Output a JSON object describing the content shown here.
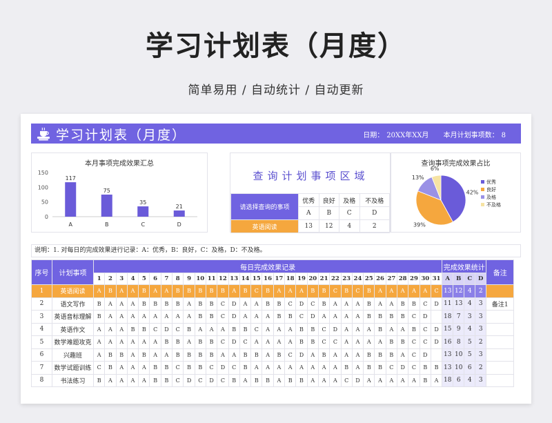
{
  "hero": {
    "title": "学习计划表（月度）",
    "subtitle": "简单易用  /  自动统计  /  自动更新"
  },
  "banner": {
    "title": "学习计划表（月度）",
    "date_label": "日期：",
    "date_value": "20XX年XX月",
    "count_label": "本月计划事项数：",
    "count_value": "8"
  },
  "bar_panel": {
    "title": "本月事项完成效果汇总"
  },
  "query_panel": {
    "title": "查询计划事项区域",
    "headers": [
      "优秀",
      "良好",
      "及格",
      "不及格"
    ],
    "codes": [
      "A",
      "B",
      "C",
      "D"
    ],
    "select_label": "请选择查询的事项",
    "selected": "英语阅读",
    "counts": [
      "13",
      "12",
      "4",
      "2"
    ]
  },
  "pie_panel": {
    "title": "查询事项完成效果占比"
  },
  "chart_data": [
    {
      "type": "bar",
      "title": "本月事项完成效果汇总",
      "categories": [
        "A",
        "B",
        "C",
        "D"
      ],
      "values": [
        117,
        75,
        35,
        21
      ],
      "ylim": [
        0,
        150
      ],
      "yticks": [
        0,
        50,
        100,
        150
      ],
      "color": "#6a5bd9",
      "grid": false
    },
    {
      "type": "pie",
      "title": "查询事项完成效果占比",
      "labels": [
        "优秀",
        "良好",
        "及格",
        "不及格"
      ],
      "values": [
        42,
        39,
        13,
        6
      ],
      "value_labels": [
        "42%",
        "39%",
        "13%",
        "6%"
      ],
      "colors": [
        "#6a5bd9",
        "#f5a73e",
        "#9a91e6",
        "#f6e3a3"
      ],
      "legend": "right"
    }
  ],
  "note": "说明：1. 对每日的完成效果进行记录：A：优秀，B：良好，C：及格，D：不及格。",
  "table": {
    "col_index": "序号",
    "col_item": "计划事项",
    "group_daily": "每日完成效果记录",
    "group_stats": "完成效果统计",
    "col_remark": "备注",
    "days": [
      "1",
      "2",
      "3",
      "4",
      "5",
      "6",
      "7",
      "8",
      "9",
      "10",
      "11",
      "12",
      "13",
      "14",
      "15",
      "16",
      "17",
      "18",
      "19",
      "20",
      "21",
      "22",
      "23",
      "24",
      "25",
      "26",
      "27",
      "28",
      "29",
      "30",
      "31"
    ],
    "stat_heads": [
      "A",
      "B",
      "C",
      "D"
    ],
    "rows": [
      {
        "idx": "1",
        "name": "英语阅读",
        "hl": true,
        "marks": [
          "A",
          "B",
          "A",
          "A",
          "B",
          "A",
          "A",
          "B",
          "B",
          "B",
          "B",
          "B",
          "A",
          "B",
          "C",
          "B",
          "A",
          "A",
          "A",
          "B",
          "B",
          "C",
          "B",
          "C",
          "B",
          "A",
          "A",
          "A",
          "A",
          "A",
          "C"
        ],
        "stats": [
          "13",
          "12",
          "4",
          "2"
        ],
        "remark": ""
      },
      {
        "idx": "2",
        "name": "语文写作",
        "hl": false,
        "marks": [
          "B",
          "A",
          "A",
          "A",
          "B",
          "B",
          "B",
          "B",
          "A",
          "B",
          "B",
          "C",
          "D",
          "A",
          "A",
          "B",
          "B",
          "C",
          "D",
          "C",
          "B",
          "A",
          "A",
          "A",
          "B",
          "A",
          "A",
          "B",
          "B",
          "C",
          "D"
        ],
        "stats": [
          "11",
          "13",
          "4",
          "3"
        ],
        "remark": "备注1"
      },
      {
        "idx": "3",
        "name": "英语音标理解",
        "hl": false,
        "marks": [
          "B",
          "A",
          "A",
          "A",
          "A",
          "A",
          "A",
          "A",
          "A",
          "B",
          "B",
          "C",
          "D",
          "A",
          "A",
          "A",
          "B",
          "B",
          "C",
          "D",
          "A",
          "A",
          "A",
          "A",
          "B",
          "B",
          "B",
          "B",
          "C",
          "D",
          ""
        ],
        "stats": [
          "18",
          "7",
          "3",
          "3"
        ],
        "remark": ""
      },
      {
        "idx": "4",
        "name": "英语作文",
        "hl": false,
        "marks": [
          "A",
          "A",
          "A",
          "B",
          "B",
          "C",
          "D",
          "C",
          "B",
          "A",
          "A",
          "A",
          "B",
          "B",
          "C",
          "A",
          "A",
          "A",
          "B",
          "B",
          "C",
          "D",
          "A",
          "A",
          "A",
          "B",
          "A",
          "A",
          "B",
          "C",
          "D"
        ],
        "stats": [
          "15",
          "9",
          "4",
          "3"
        ],
        "remark": ""
      },
      {
        "idx": "5",
        "name": "数学难题攻克",
        "hl": false,
        "marks": [
          "A",
          "A",
          "A",
          "A",
          "A",
          "A",
          "B",
          "B",
          "A",
          "B",
          "B",
          "C",
          "D",
          "C",
          "A",
          "A",
          "A",
          "A",
          "B",
          "B",
          "C",
          "C",
          "A",
          "A",
          "A",
          "A",
          "B",
          "B",
          "C",
          "C",
          "D"
        ],
        "stats": [
          "16",
          "8",
          "5",
          "2"
        ],
        "remark": ""
      },
      {
        "idx": "6",
        "name": "兴趣班",
        "hl": false,
        "marks": [
          "A",
          "B",
          "B",
          "A",
          "B",
          "A",
          "A",
          "B",
          "B",
          "B",
          "B",
          "A",
          "A",
          "B",
          "B",
          "A",
          "B",
          "C",
          "D",
          "A",
          "B",
          "A",
          "A",
          "A",
          "B",
          "B",
          "B",
          "A",
          "C",
          "D",
          ""
        ],
        "stats": [
          "13",
          "10",
          "5",
          "3"
        ],
        "remark": ""
      },
      {
        "idx": "7",
        "name": "数学试题训练",
        "hl": false,
        "marks": [
          "C",
          "B",
          "A",
          "A",
          "A",
          "B",
          "B",
          "C",
          "B",
          "B",
          "C",
          "D",
          "C",
          "B",
          "A",
          "A",
          "A",
          "A",
          "A",
          "A",
          "A",
          "A",
          "B",
          "A",
          "B",
          "B",
          "C",
          "D",
          "C",
          "B",
          "B"
        ],
        "stats": [
          "13",
          "10",
          "6",
          "2"
        ],
        "remark": ""
      },
      {
        "idx": "8",
        "name": "书法练习",
        "hl": false,
        "marks": [
          "B",
          "A",
          "A",
          "A",
          "A",
          "B",
          "B",
          "C",
          "D",
          "C",
          "D",
          "C",
          "B",
          "A",
          "B",
          "B",
          "A",
          "B",
          "B",
          "A",
          "A",
          "A",
          "C",
          "D",
          "A",
          "A",
          "A",
          "A",
          "A",
          "B",
          "A"
        ],
        "stats": [
          "18",
          "6",
          "4",
          "3"
        ],
        "remark": ""
      }
    ]
  }
}
